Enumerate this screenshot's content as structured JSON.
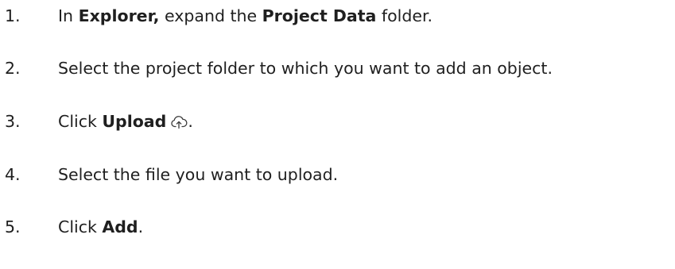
{
  "steps": [
    {
      "number": "1.",
      "parts": [
        "In ",
        "Explorer,",
        " expand the ",
        "Project Data",
        " folder."
      ]
    },
    {
      "number": "2.",
      "text": "Select the project folder to which you want to add an object."
    },
    {
      "number": "3.",
      "parts": [
        "Click ",
        "Upload",
        "."
      ],
      "icon": "cloud-upload-icon"
    },
    {
      "number": "4.",
      "text": "Select the file you want to upload."
    },
    {
      "number": "5.",
      "parts": [
        "Click ",
        "Add",
        "."
      ]
    }
  ]
}
